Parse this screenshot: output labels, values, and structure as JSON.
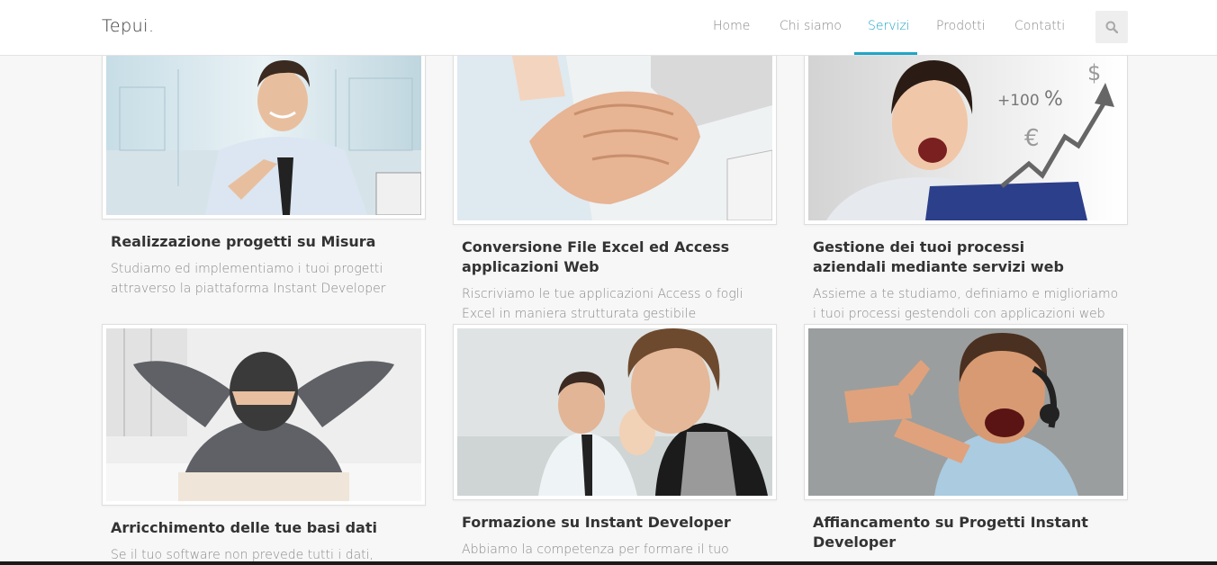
{
  "header": {
    "logo": "Tepui.",
    "nav": [
      {
        "label": "Home",
        "active": false
      },
      {
        "label": "Chi siamo",
        "active": false
      },
      {
        "label": "Servizi",
        "active": true
      },
      {
        "label": "Prodotti",
        "active": false
      },
      {
        "label": "Contatti",
        "active": false
      }
    ],
    "search_icon": "search-icon"
  },
  "colors": {
    "accent": "#1fa5c6",
    "title": "#333333",
    "text": "#8a8a8a",
    "background": "#f7f7f7"
  },
  "services": [
    {
      "title": "Realizzazione progetti su Misura",
      "description": "Studiamo ed implementiamo i tuoi progetti attraverso la piattaforma Instant Developer",
      "image": "man-handshake-office-photo"
    },
    {
      "title": "Conversione File Excel ed Access applicazioni Web",
      "description": "Riscriviamo le tue applicazioni Access o fogli Excel in maniera strutturata gestibile",
      "image": "handshake-closeup-photo"
    },
    {
      "title": "Gestione dei tuoi processi aziendali mediante servizi web",
      "description": "Assieme a te studiamo, definiamo e miglioriamo i tuoi processi gestendoli con applicazioni web",
      "image": "excited-woman-growth-chart-photo",
      "overlay_text": [
        "+100",
        "%",
        "€",
        "$"
      ]
    },
    {
      "title": "Arricchimento delle tue basi dati",
      "description": "Se il tuo software non prevede tutti i dati,",
      "image": "relaxed-businessman-back-photo"
    },
    {
      "title": "Formazione su Instant Developer",
      "description": "Abbiamo la competenza per formare il tuo",
      "image": "team-meeting-photo"
    },
    {
      "title": "Affiancamento su Progetti Instant Developer",
      "description": "",
      "image": "thumbs-up-headset-photo"
    }
  ]
}
